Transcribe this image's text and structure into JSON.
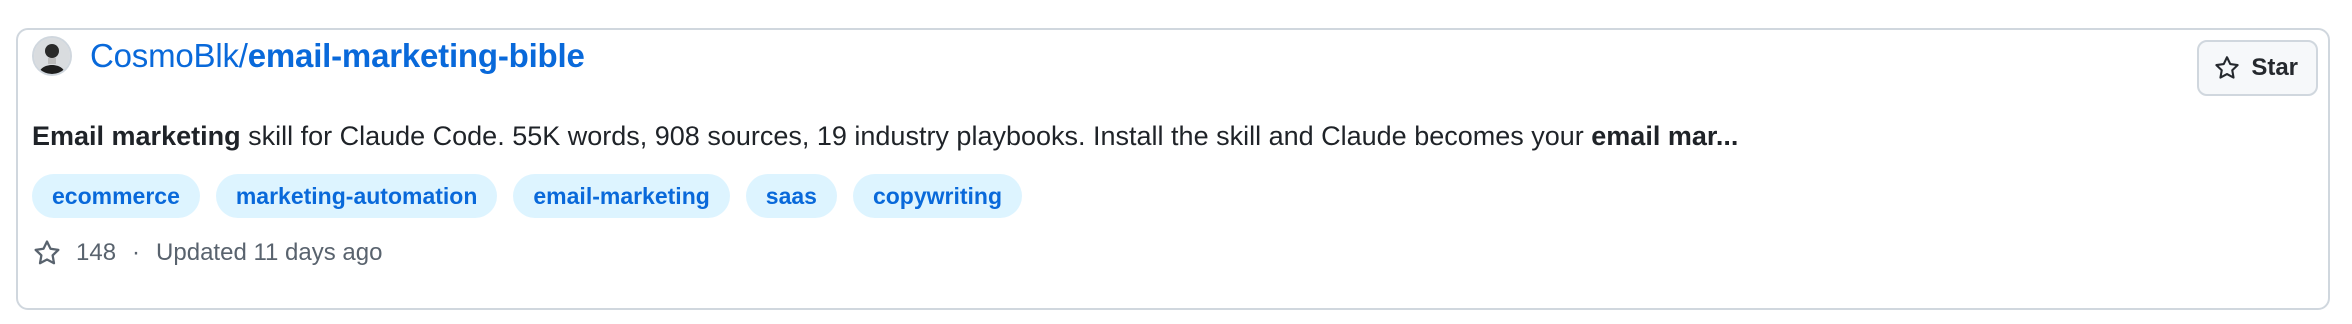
{
  "repo": {
    "owner": "CosmoBlk/",
    "name": "email-marketing-bible"
  },
  "description": {
    "part1_bold": "Email marketing",
    "part2": " skill for Claude Code. 55K words, 908 sources, 19 industry playbooks. Install the skill and Claude becomes your ",
    "part3_bold": "email mar..."
  },
  "topics": [
    {
      "label": "ecommerce"
    },
    {
      "label": "marketing-automation"
    },
    {
      "label": "email-marketing"
    },
    {
      "label": "saas"
    },
    {
      "label": "copywriting"
    }
  ],
  "meta": {
    "stars": "148",
    "separator": "·",
    "updated": "Updated 11 days ago"
  },
  "star_button": {
    "label": "Star",
    "icon": "star-icon"
  },
  "colors": {
    "link": "#0969da",
    "topic_bg": "#ddf4ff",
    "muted_text": "#59636e",
    "border": "#d0d7de"
  }
}
